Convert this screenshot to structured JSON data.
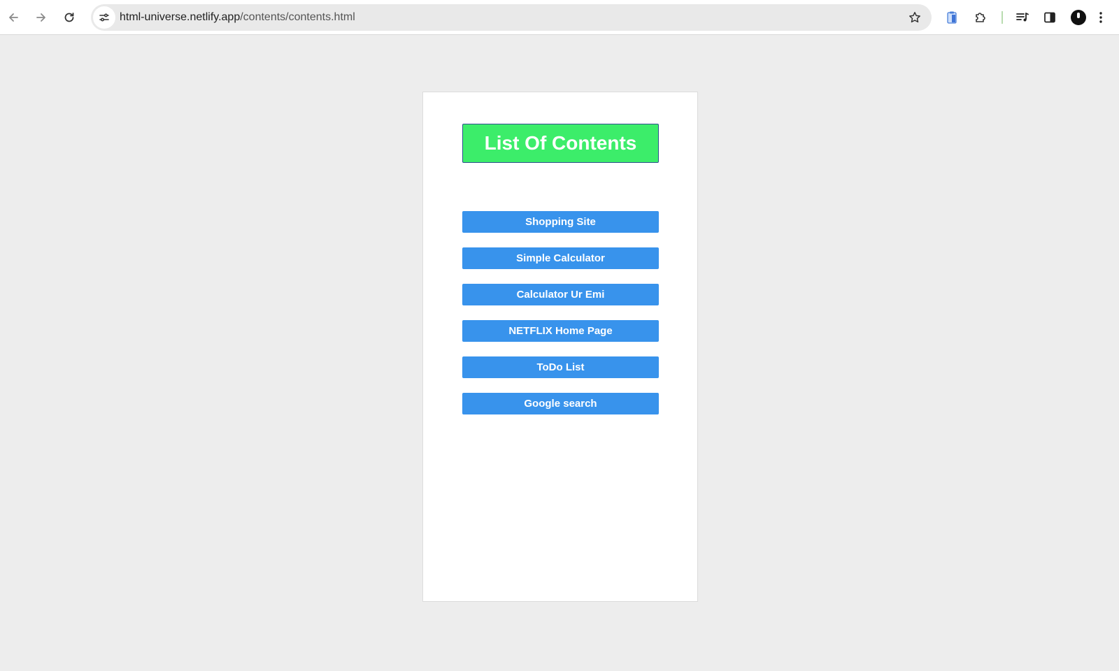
{
  "browser": {
    "url_host": "html-universe.netlify.app",
    "url_path": "/contents/contents.html",
    "icons": {
      "back": "arrow-left-icon",
      "forward": "arrow-right-icon",
      "reload": "reload-icon",
      "site_info": "tune-icon",
      "bookmark": "star-icon",
      "extension_1": "clipboard-extension-icon",
      "extensions": "puzzle-icon",
      "media": "media-controls-icon",
      "side_panel": "side-panel-icon",
      "profile": "avatar",
      "menu": "kebab-menu-icon"
    }
  },
  "page": {
    "heading": "List Of Contents",
    "links": [
      {
        "label": "Shopping Site"
      },
      {
        "label": "Simple Calculator"
      },
      {
        "label": "Calculator Ur Emi"
      },
      {
        "label": "NETFLIX Home Page"
      },
      {
        "label": "ToDo List"
      },
      {
        "label": "Google search"
      }
    ]
  },
  "colors": {
    "background": "#ededed",
    "card": "#ffffff",
    "heading_bg": "#3ced6a",
    "button_bg": "#3893ec",
    "button_text": "#ffffff"
  }
}
